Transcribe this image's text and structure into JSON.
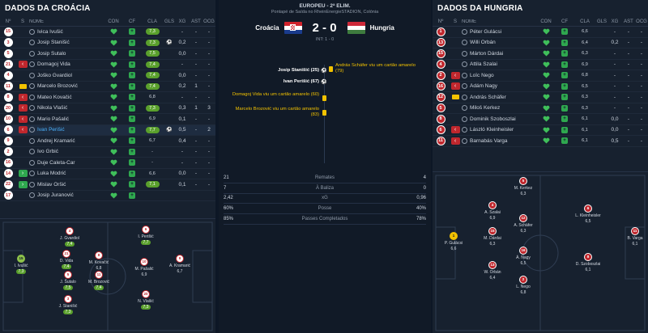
{
  "match": {
    "competition": "EUROPEU - 2ª ELIM.",
    "venue": "Pontapé de Saída no RheinEnergieSTADION, Colónia",
    "home": "Croácia",
    "away": "Hungria",
    "score": "2 - 0",
    "interval": "INT: 1 - 0"
  },
  "events": [
    {
      "text": "Josip Stanišić (25)",
      "type": "goal"
    },
    {
      "text": "Ivan Perišić (67)",
      "type": "goal"
    },
    {
      "text": "András Schäfer viu um cartão amarelo (79)",
      "type": "card"
    },
    {
      "text": "Domagoj Vida viu um cartão amarelo (60)",
      "type": "card"
    },
    {
      "text": "Marcelo Brozović viu um cartão amarelo (83)",
      "type": "card"
    }
  ],
  "stats": [
    {
      "home": "21",
      "label": "Remates",
      "away": "4"
    },
    {
      "home": "7",
      "label": "À Baliza",
      "away": "0"
    },
    {
      "home": "2,42",
      "label": "xG",
      "away": "0,96"
    },
    {
      "home": "60%",
      "label": "Posse",
      "away": "40%"
    },
    {
      "home": "85%",
      "label": "Passes Completados",
      "away": "78%"
    }
  ],
  "headers": {
    "no": "Nº",
    "s": "S",
    "name": "NOME",
    "con": "CON",
    "cf": "CF",
    "cla": "CLA",
    "gls": "GLS",
    "xg": "XG",
    "ast": "AST",
    "ocg": "OCG"
  },
  "croatia": {
    "title": "DADOS DA CROÁCIA",
    "rows": [
      {
        "no": "15",
        "name": "Ivica Ivušić",
        "cla": "7,3",
        "xg": "-",
        "ast": "-",
        "ocg": "-"
      },
      {
        "no": "3",
        "name": "Josip Stanišić",
        "cla": "7,3",
        "gls": "1",
        "xg": "0,2",
        "ast": "-",
        "ocg": "-"
      },
      {
        "no": "5",
        "name": "Josip Šutalo",
        "cla": "7,5",
        "xg": "0,0",
        "ast": "-",
        "ocg": "-"
      },
      {
        "no": "21",
        "name": "Domagoj Vida",
        "cla": "7,4",
        "xg": "-",
        "ast": "-",
        "ocg": "-",
        "sub": "out"
      },
      {
        "no": "4",
        "name": "Joško Gvardiol",
        "cla": "7,4",
        "xg": "0,0",
        "ast": "-",
        "ocg": "-"
      },
      {
        "no": "11",
        "name": "Marcelo Brozović",
        "cla": "7,4",
        "xg": "0,2",
        "ast": "1",
        "ocg": "-",
        "card": "yes"
      },
      {
        "no": "8",
        "name": "Mateo Kovačić",
        "cla": "6,8",
        "xg": "-",
        "ast": "-",
        "ocg": "-",
        "sub": "out"
      },
      {
        "no": "20",
        "name": "Nikola Vlašić",
        "cla": "7,3",
        "xg": "0,3",
        "ast": "1",
        "ocg": "3",
        "sub": "out"
      },
      {
        "no": "10",
        "name": "Mario Pašalić",
        "cla": "6,9",
        "xg": "0,1",
        "ast": "-",
        "ocg": "-",
        "sub": "out"
      },
      {
        "no": "6",
        "name": "Ivan Perišić",
        "cla": "7,7",
        "gls": "1",
        "xg": "0,5",
        "ast": "-",
        "ocg": "2",
        "sub": "out",
        "sel": "yes"
      },
      {
        "no": "9",
        "name": "Andrej Kramarić",
        "cla": "6,7",
        "xg": "0,4",
        "ast": "-",
        "ocg": "-"
      },
      {
        "no": "2",
        "name": "Ivo Grbić",
        "cla": "-",
        "xg": "-",
        "ast": "-",
        "ocg": "-"
      },
      {
        "no": "16",
        "name": "Duje Caleta-Car",
        "cla": "-",
        "xg": "-",
        "ast": "-",
        "ocg": "-"
      },
      {
        "no": "14",
        "name": "Luka Modrić",
        "cla": "6,6",
        "xg": "0,0",
        "ast": "-",
        "ocg": "-",
        "sub": "in"
      },
      {
        "no": "22",
        "name": "Mislav Oršić",
        "cla": "7,1",
        "xg": "0,1",
        "ast": "-",
        "ocg": "-",
        "sub": "in"
      },
      {
        "no": "17",
        "name": "Josip Juranović",
        "cla": "",
        "xg": "",
        "ast": "",
        "ocg": ""
      }
    ]
  },
  "hungary": {
    "title": "DADOS DA HUNGRIA",
    "rows": [
      {
        "no": "1",
        "name": "Péter Gulácsi",
        "cla": "6,6",
        "xg": "-",
        "ast": "-",
        "ocg": "-"
      },
      {
        "no": "13",
        "name": "Willi Orbán",
        "cla": "6,4",
        "xg": "0,2",
        "ast": "-",
        "ocg": "-"
      },
      {
        "no": "15",
        "name": "Márton Dárdai",
        "cla": "6,3",
        "xg": "-",
        "ast": "-",
        "ocg": "-"
      },
      {
        "no": "4",
        "name": "Attila Szalai",
        "cla": "6,9",
        "xg": "-",
        "ast": "-",
        "ocg": "-"
      },
      {
        "no": "2",
        "name": "Loïc Nego",
        "cla": "6,8",
        "xg": "-",
        "ast": "-",
        "ocg": "-",
        "sub": "out"
      },
      {
        "no": "16",
        "name": "Ádám Nagy",
        "cla": "6,5",
        "xg": "-",
        "ast": "-",
        "ocg": "-",
        "sub": "out"
      },
      {
        "no": "12",
        "name": "András Schäfer",
        "cla": "6,3",
        "xg": "-",
        "ast": "-",
        "ocg": "-",
        "card": "yes"
      },
      {
        "no": "5",
        "name": "Miloš Kerkez",
        "cla": "6,3",
        "xg": "-",
        "ast": "-",
        "ocg": "-"
      },
      {
        "no": "8",
        "name": "Dominik Szoboszlai",
        "cla": "6,1",
        "xg": "0,0",
        "ast": "-",
        "ocg": "-"
      },
      {
        "no": "6",
        "name": "László Kleinheisler",
        "cla": "6,1",
        "xg": "0,0",
        "ast": "-",
        "ocg": "-",
        "sub": "out"
      },
      {
        "no": "11",
        "name": "Barnabás Varga",
        "cla": "6,1",
        "xg": "0,5",
        "ast": "-",
        "ocg": "-",
        "sub": "out"
      }
    ]
  },
  "pitch_croatia": [
    {
      "no": "15",
      "name": "I. Ivušić",
      "r": "7,3",
      "gk": "yes"
    },
    {
      "no": "4",
      "name": "J. Gvardiol",
      "r": "7,4"
    },
    {
      "no": "21",
      "name": "D. Vida",
      "r": "7,4"
    },
    {
      "no": "5",
      "name": "J. Šutalo",
      "r": "7,5"
    },
    {
      "no": "3",
      "name": "J. Stanišić",
      "r": "7,3"
    },
    {
      "no": "8",
      "name": "M. Kovačić",
      "r": "6,8"
    },
    {
      "no": "11",
      "name": "M. Brozović",
      "r": "7,4"
    },
    {
      "no": "6",
      "name": "I. Perišić",
      "r": "7,7"
    },
    {
      "no": "10",
      "name": "M. Pašalić",
      "r": "6,9"
    },
    {
      "no": "20",
      "name": "N. Vlašić",
      "r": "7,3"
    },
    {
      "no": "9",
      "name": "A. Kramarić",
      "r": "6,7"
    }
  ],
  "pitch_hungary": [
    {
      "no": "1",
      "name": "P. Gulácsi",
      "r": "6,6",
      "gk": "yes"
    },
    {
      "no": "4",
      "name": "A. Szalai",
      "r": "6,9"
    },
    {
      "no": "15",
      "name": "M. Dárdai",
      "r": "6,3"
    },
    {
      "no": "13",
      "name": "W. Orbán",
      "r": "6,4"
    },
    {
      "no": "5",
      "name": "M. Kerkez",
      "r": "6,3"
    },
    {
      "no": "12",
      "name": "A. Schäfer",
      "r": "6,3"
    },
    {
      "no": "16",
      "name": "Á. Nagy",
      "r": "6,5"
    },
    {
      "no": "2",
      "name": "L. Nego",
      "r": "6,8"
    },
    {
      "no": "6",
      "name": "L. Kleinheisler",
      "r": "6,5"
    },
    {
      "no": "8",
      "name": "D. Szoboszlai",
      "r": "6,1"
    },
    {
      "no": "11",
      "name": "B. Varga",
      "r": "6,1"
    }
  ]
}
